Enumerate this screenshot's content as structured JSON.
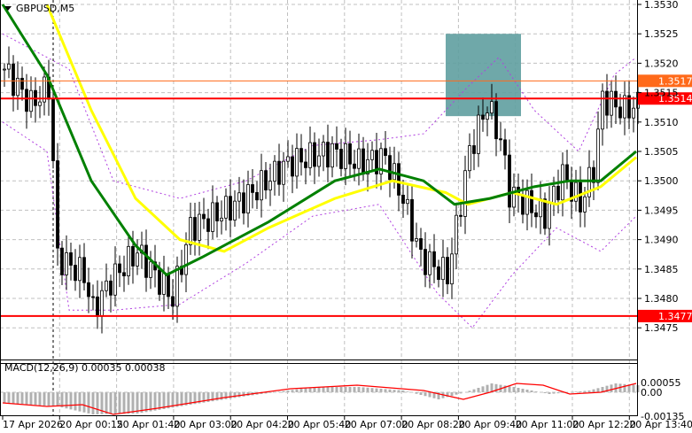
{
  "symbol_label": "GBPUSD,M5",
  "macd_label": "MACD(12,26,9) 0.00035 0.00038",
  "price_axis": [
    "1.3530",
    "1.3525",
    "1.3520",
    "1.3515",
    "1.3510",
    "1.3505",
    "1.3500",
    "1.3495",
    "1.3490",
    "1.3485",
    "1.3480",
    "1.3475"
  ],
  "macd_axis": [
    "0.00055",
    "0.00",
    "-0.00135"
  ],
  "time_axis": [
    "17 Apr 2026",
    "20 Apr 00:15",
    "20 Apr 01:40",
    "20 Apr 03:00",
    "20 Apr 04:20",
    "20 Apr 05:40",
    "20 Apr 07:00",
    "20 Apr 08:20",
    "20 Apr 09:40",
    "20 Apr 11:00",
    "20 Apr 12:20",
    "20 Apr 13:40"
  ],
  "levels": [
    {
      "price": 1.3517,
      "label": "1.3517",
      "color": "#ff6a1a"
    },
    {
      "price": 1.3514,
      "label": "1.3514",
      "color": "#ff0000"
    },
    {
      "price": 1.3477,
      "label": "1.3477",
      "color": "#ff0000"
    }
  ],
  "chart_data": {
    "type": "candlestick",
    "ylim": [
      1.347,
      1.3531
    ],
    "close_keypoints": [
      [
        0,
        1.3519
      ],
      [
        6,
        1.3513
      ],
      [
        10,
        1.3516
      ],
      [
        11,
        1.3503
      ],
      [
        12,
        1.3487
      ],
      [
        18,
        1.3484
      ],
      [
        20,
        1.3478
      ],
      [
        24,
        1.3483
      ],
      [
        30,
        1.3488
      ],
      [
        35,
        1.3483
      ],
      [
        38,
        1.348
      ],
      [
        42,
        1.3492
      ],
      [
        50,
        1.3495
      ],
      [
        56,
        1.3498
      ],
      [
        64,
        1.3503
      ],
      [
        74,
        1.3505
      ],
      [
        80,
        1.3503
      ],
      [
        86,
        1.3504
      ],
      [
        90,
        1.3497
      ],
      [
        94,
        1.3487
      ],
      [
        100,
        1.3484
      ],
      [
        102,
        1.3492
      ],
      [
        105,
        1.3505
      ],
      [
        109,
        1.3513
      ],
      [
        112,
        1.3507
      ],
      [
        114,
        1.3498
      ],
      [
        118,
        1.3496
      ],
      [
        122,
        1.3494
      ],
      [
        126,
        1.3501
      ],
      [
        130,
        1.3496
      ],
      [
        133,
        1.3502
      ],
      [
        135,
        1.3514
      ],
      [
        140,
        1.3512
      ],
      [
        143,
        1.3513
      ]
    ],
    "ma_green": [
      [
        0,
        1.353
      ],
      [
        10,
        1.3518
      ],
      [
        20,
        1.35
      ],
      [
        30,
        1.3489
      ],
      [
        37,
        1.3484
      ],
      [
        45,
        1.3487
      ],
      [
        60,
        1.3493
      ],
      [
        75,
        1.35
      ],
      [
        85,
        1.3502
      ],
      [
        95,
        1.35
      ],
      [
        102,
        1.3496
      ],
      [
        110,
        1.3497
      ],
      [
        120,
        1.3499
      ],
      [
        128,
        1.35
      ],
      [
        135,
        1.35
      ],
      [
        143,
        1.3505
      ]
    ],
    "ma_yellow": [
      [
        10,
        1.353
      ],
      [
        20,
        1.3512
      ],
      [
        30,
        1.3497
      ],
      [
        40,
        1.349
      ],
      [
        50,
        1.3488
      ],
      [
        60,
        1.3492
      ],
      [
        75,
        1.3497
      ],
      [
        88,
        1.35
      ],
      [
        100,
        1.3498
      ],
      [
        105,
        1.3496
      ],
      [
        115,
        1.3498
      ],
      [
        125,
        1.3496
      ],
      [
        135,
        1.3499
      ],
      [
        143,
        1.3504
      ]
    ],
    "bb_upper": [
      [
        0,
        1.3525
      ],
      [
        15,
        1.3519
      ],
      [
        25,
        1.35
      ],
      [
        40,
        1.3497
      ],
      [
        55,
        1.35
      ],
      [
        70,
        1.3506
      ],
      [
        85,
        1.3507
      ],
      [
        95,
        1.3508
      ],
      [
        105,
        1.3516
      ],
      [
        112,
        1.3521
      ],
      [
        120,
        1.3512
      ],
      [
        130,
        1.3505
      ],
      [
        138,
        1.3518
      ],
      [
        143,
        1.3521
      ]
    ],
    "bb_lower": [
      [
        0,
        1.351
      ],
      [
        10,
        1.3505
      ],
      [
        15,
        1.3478
      ],
      [
        25,
        1.3478
      ],
      [
        40,
        1.3479
      ],
      [
        55,
        1.3486
      ],
      [
        70,
        1.3494
      ],
      [
        85,
        1.3496
      ],
      [
        98,
        1.3481
      ],
      [
        106,
        1.3475
      ],
      [
        115,
        1.3484
      ],
      [
        125,
        1.3492
      ],
      [
        135,
        1.3488
      ],
      [
        143,
        1.3494
      ]
    ],
    "macd_hist_keypoints": [
      [
        0,
        -0.0006
      ],
      [
        12,
        -0.0008
      ],
      [
        20,
        -0.00125
      ],
      [
        30,
        -0.0012
      ],
      [
        42,
        -0.0007
      ],
      [
        55,
        -0.0002
      ],
      [
        70,
        0.0003
      ],
      [
        80,
        0.0003
      ],
      [
        90,
        0.0001
      ],
      [
        98,
        -0.0004
      ],
      [
        104,
        0.0
      ],
      [
        110,
        0.0005
      ],
      [
        115,
        0.0003
      ],
      [
        123,
        -0.0001
      ],
      [
        132,
        0.0001
      ],
      [
        138,
        0.0005
      ],
      [
        143,
        0.0004
      ]
    ],
    "macd_signal_keypoints": [
      [
        0,
        -0.0006
      ],
      [
        10,
        -0.0008
      ],
      [
        18,
        -0.0007
      ],
      [
        25,
        -0.00125
      ],
      [
        35,
        -0.0009
      ],
      [
        50,
        -0.0003
      ],
      [
        65,
        0.0002
      ],
      [
        80,
        0.0004
      ],
      [
        95,
        0.0001
      ],
      [
        104,
        -0.0004
      ],
      [
        110,
        0.0
      ],
      [
        116,
        0.0005
      ],
      [
        122,
        0.0004
      ],
      [
        128,
        -0.0001
      ],
      [
        135,
        0.0
      ],
      [
        143,
        0.0005
      ]
    ]
  },
  "highlight_box": {
    "price_top": 1.3525,
    "price_bottom": 1.3511,
    "index_from": 100,
    "index_to": 117,
    "color": "#5f9ea0"
  }
}
